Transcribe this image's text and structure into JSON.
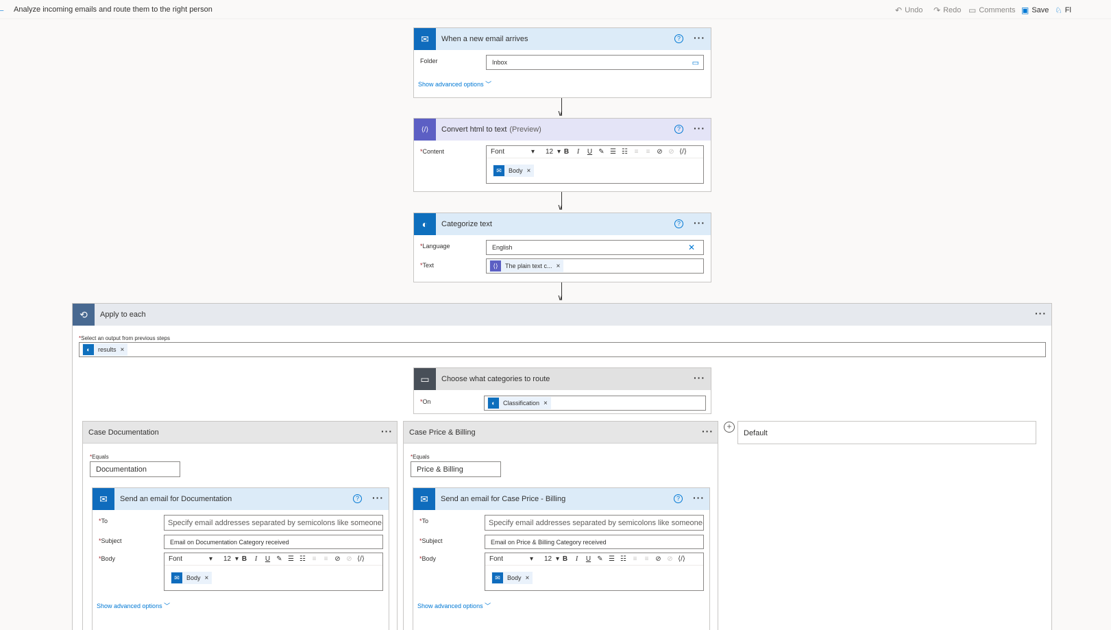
{
  "header": {
    "title": "Analyze incoming emails and route them to the right person",
    "undo": "Undo",
    "redo": "Redo",
    "comments": "Comments",
    "save": "Save",
    "flow_checker": "Fl"
  },
  "colors": {
    "outlook": "#0f6cbd",
    "html_text": "#5c5fc4",
    "cognitive": "#0e6fbd",
    "loop": "#486991",
    "switch": "#484f58"
  },
  "icons": {
    "outlook": "outlook-icon",
    "html": "html-to-text-icon",
    "cognitive": "brain-icon",
    "loop": "loop-icon",
    "switch": "switch-icon"
  },
  "trigger": {
    "title": "When a new email arrives",
    "folder_label": "Folder",
    "folder_value": "Inbox",
    "advanced": "Show advanced options"
  },
  "convert": {
    "title": "Convert html to text",
    "preview": "(Preview)",
    "content_label": "Content",
    "token": "Body"
  },
  "rte": {
    "font": "Font",
    "size": "12",
    "bold": "B",
    "italic": "I",
    "underline": "U"
  },
  "categorize": {
    "title": "Categorize text",
    "language_label": "Language",
    "language_value": "English",
    "text_label": "Text",
    "text_token": "The plain text c..."
  },
  "loop": {
    "title": "Apply to each",
    "select_label": "Select an output from previous steps",
    "token": "results"
  },
  "switch": {
    "title": "Choose what categories to route",
    "on_label": "On",
    "on_token": "Classification"
  },
  "cases": [
    {
      "title": "Case Documentation",
      "equals_label": "Equals",
      "equals_value": "Documentation",
      "action_title": "Send an email for Documentation",
      "to_label": "To",
      "to_placeholder": "Specify email addresses separated by semicolons like someone@contoso.com",
      "subject_label": "Subject",
      "subject_value": "Email on Documentation Category received",
      "body_label": "Body",
      "body_token": "Body",
      "advanced": "Show advanced options"
    },
    {
      "title": "Case Price & Billing",
      "equals_label": "Equals",
      "equals_value": "Price & Billing",
      "action_title": "Send an email for Case Price - Billing",
      "to_label": "To",
      "to_placeholder": "Specify email addresses separated by semicolons like someone@contoso.com",
      "subject_label": "Subject",
      "subject_value": "Email on Price & Billing Category received",
      "body_label": "Body",
      "body_token": "Body",
      "advanced": "Show advanced options"
    }
  ],
  "default_case": {
    "title": "Default"
  }
}
